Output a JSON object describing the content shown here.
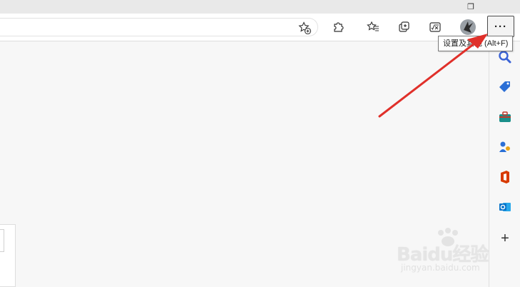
{
  "window": {
    "restore_glyph": "❐"
  },
  "toolbar": {
    "favorites_add_icon": "star-plus-icon",
    "extensions_icon": "puzzle-icon",
    "favorites_icon": "favorites-list-icon",
    "collections_icon": "collections-icon",
    "math_solver_icon": "math-solver-icon",
    "profile_icon": "profile-avatar-icon",
    "more_label": "···"
  },
  "tooltip": {
    "text": "设置及其他 (Alt+F)"
  },
  "sidebar": {
    "items": [
      {
        "name": "search",
        "icon": "search-icon"
      },
      {
        "name": "shopping",
        "icon": "tag-icon"
      },
      {
        "name": "tools",
        "icon": "toolbox-icon"
      },
      {
        "name": "games",
        "icon": "games-icon"
      },
      {
        "name": "office",
        "icon": "office-icon"
      },
      {
        "name": "outlook",
        "icon": "outlook-icon"
      }
    ],
    "add_label": "+"
  },
  "watermark": {
    "text": "Baidu经验",
    "subtext": "jingyan.baidu.com"
  },
  "colors": {
    "arrow": "#e0302a",
    "search": "#3a63d6",
    "tag": "#2b6fd6",
    "office": "#d83b01",
    "outlook": "#0a74c9",
    "toolbox": "#1a8f8a"
  }
}
